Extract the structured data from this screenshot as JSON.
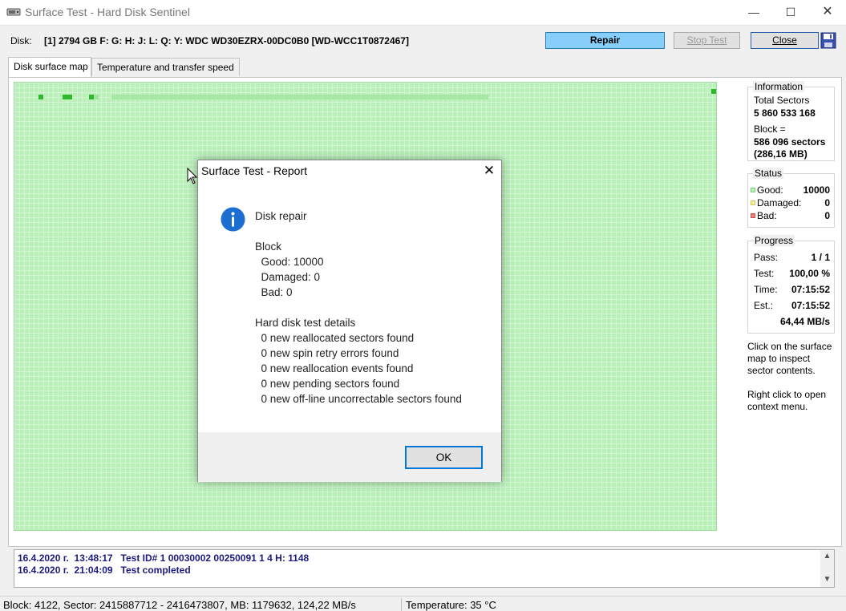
{
  "window": {
    "title": "Surface Test - Hard Disk Sentinel",
    "min": "—",
    "max": "☐",
    "close": "✕"
  },
  "disk": {
    "label": "Disk:",
    "value": "[1] 2794 GB F: G: H: J: L: Q: Y: WDC WD30EZRX-00DC0B0 [WD-WCC1T0872467]"
  },
  "buttons": {
    "repair": "Repair",
    "stop_test": "Stop Test",
    "close": "Close"
  },
  "tabs": [
    {
      "label": "Disk surface map"
    },
    {
      "label": "Temperature and transfer speed"
    }
  ],
  "information": {
    "title": "Information",
    "total_sectors_label": "Total Sectors",
    "total_sectors_value": "5 860 533 168",
    "block_label": "Block =",
    "block_sectors": "586 096 sectors",
    "block_size": "(286,16 MB)"
  },
  "status": {
    "title": "Status",
    "good_label": "Good:",
    "good_value": "10000",
    "damaged_label": "Damaged:",
    "damaged_value": "0",
    "bad_label": "Bad:",
    "bad_value": "0",
    "good_color": "#b8f0b8",
    "damaged_color": "#f5f0a0",
    "bad_color": "#f08080"
  },
  "progress": {
    "title": "Progress",
    "pass_label": "Pass:",
    "pass_value": "1 / 1",
    "test_label": "Test:",
    "test_value": "100,00 %",
    "time_label": "Time:",
    "time_value": "07:15:52",
    "est_label": "Est.:",
    "est_value": "07:15:52",
    "speed": "64,44 MB/s"
  },
  "help": {
    "click_line1": "Click on the surface",
    "click_line2": "map to inspect",
    "click_line3": "sector contents.",
    "right_line1": "Right click to open",
    "right_line2": "context menu."
  },
  "log": [
    "16.4.2020 г.  13:48:17   Test ID# 1 00030002 00250091 1 4 H: 1148",
    "16.4.2020 г.  21:04:09   Test completed"
  ],
  "statusbar": {
    "block_info": "Block: 4122, Sector: 2415887712 - 2416473807, MB: 1179632, 124,22 MB/s",
    "temperature": "Temperature: 35  °C"
  },
  "dialog": {
    "title": "Surface Test - Report",
    "heading": "Disk repair",
    "block_title": "Block",
    "good": "  Good: 10000",
    "damaged": "  Damaged: 0",
    "bad": "  Bad: 0",
    "details_title": "Hard disk test details",
    "detail_1": "  0 new reallocated sectors found",
    "detail_2": "  0 new spin retry errors found",
    "detail_3": "  0 new reallocation events found",
    "detail_4": "  0 new pending sectors found",
    "detail_5": "  0 new off-line uncorrectable sectors found",
    "ok": "OK",
    "icon": "info-icon"
  }
}
